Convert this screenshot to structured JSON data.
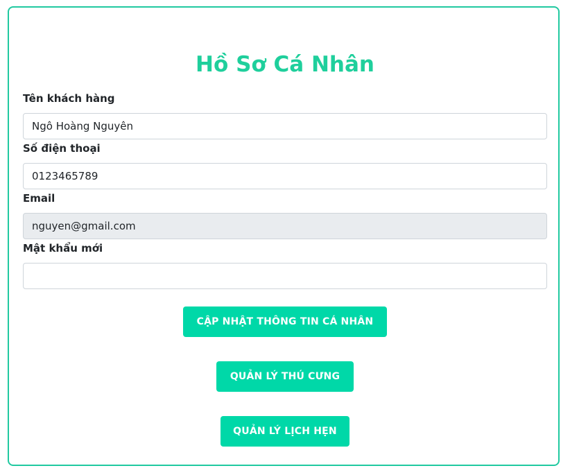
{
  "profile": {
    "title": "Hồ Sơ Cá Nhân",
    "fields": {
      "name": {
        "label": "Tên khách hàng",
        "value": "Ngô Hoàng Nguyên"
      },
      "phone": {
        "label": "Số điện thoại",
        "value": "0123465789"
      },
      "email": {
        "label": "Email",
        "value": "nguyen@gmail.com"
      },
      "password": {
        "label": "Mật khẩu mới",
        "value": ""
      }
    },
    "buttons": {
      "update": "CẬP NHẬT THÔNG TIN CÁ NHÂN",
      "pets": "QUẢN LÝ THÚ CƯNG",
      "appointments": "QUẢN LÝ LỊCH HẸN"
    },
    "colors": {
      "accent": "#00d8a8",
      "title": "#1fcf9c",
      "border": "#20c9a0",
      "disabled_bg": "#e9ecef"
    }
  }
}
